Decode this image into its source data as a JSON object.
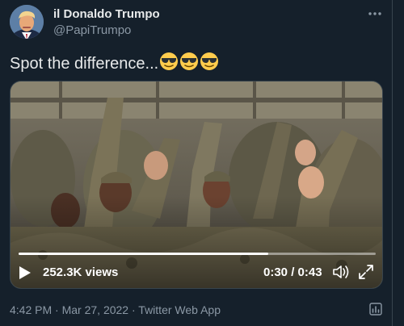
{
  "author": {
    "display_name": "il Donaldo Trumpo",
    "handle": "@PapiTrumpo"
  },
  "tweet": {
    "text": "Spot the difference...",
    "emojis": [
      "sunglasses-emoji",
      "sunglasses-emoji",
      "sunglasses-emoji"
    ]
  },
  "video": {
    "views": "252.3K views",
    "time": "0:30 / 0:43",
    "progress_fraction": 0.7
  },
  "footer": {
    "time": "4:42 PM",
    "date": "Mar 27, 2022",
    "source": "Twitter Web App",
    "separator": "·"
  },
  "icons": {
    "more": "more-icon",
    "play": "play-icon",
    "volume": "volume-icon",
    "fullscreen": "fullscreen-icon",
    "analytics": "analytics-icon"
  },
  "colors": {
    "background": "#15202b",
    "text": "#e7e9ea",
    "secondary": "#8b98a5",
    "border": "#38444d"
  }
}
